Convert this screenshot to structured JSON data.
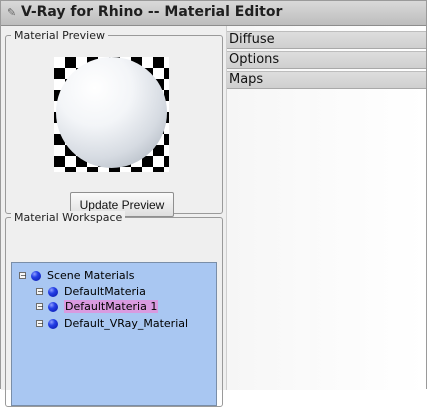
{
  "window": {
    "title": "V-Ray for Rhino -- Material Editor"
  },
  "left": {
    "material_preview": {
      "label": "Material Preview",
      "update_button": "Update Preview"
    },
    "material_workspace": {
      "label": "Material Workspace",
      "tree": {
        "root": "Scene Materials",
        "items": [
          "DefaultMateria",
          "DefaultMateria 1",
          "Default_VRay_Material"
        ],
        "selected_index": 1
      }
    }
  },
  "right": {
    "sections": [
      "Diffuse",
      "Options",
      "Maps"
    ]
  },
  "colors": {
    "workspace_bg": "#a9c7f2",
    "selection": "#d99be0",
    "sphere_ball": "#1f3bff"
  }
}
